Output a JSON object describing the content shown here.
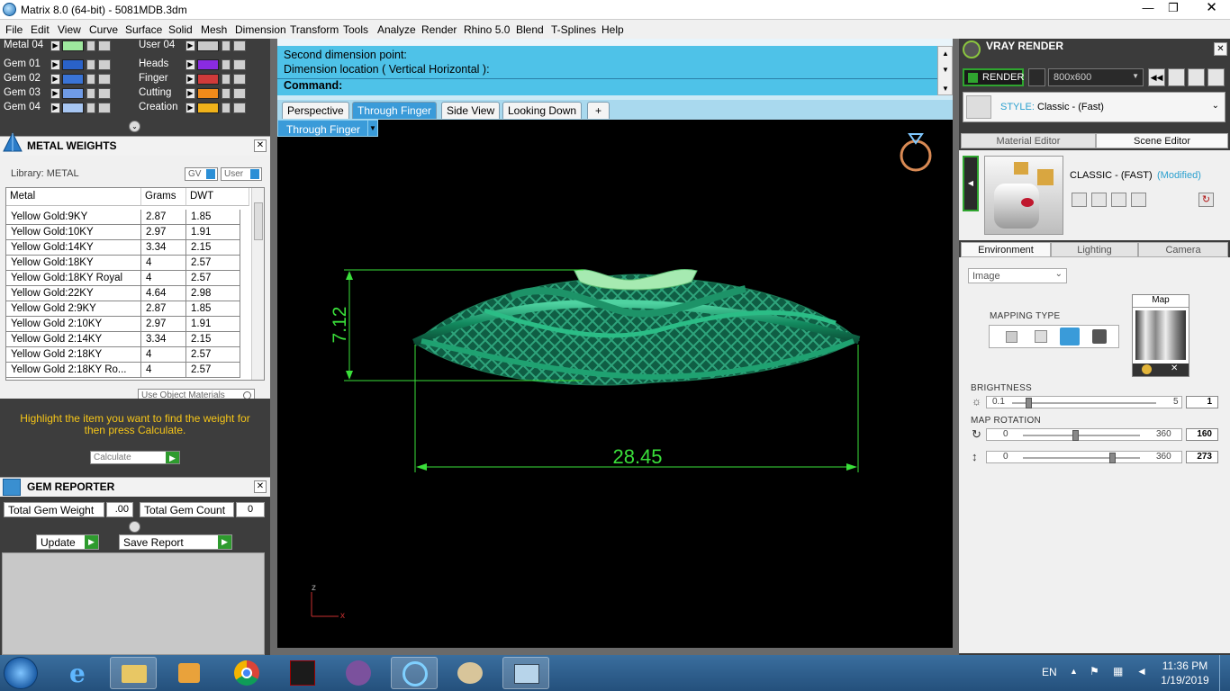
{
  "window": {
    "title": "Matrix 8.0 (64-bit) - 5081MDB.3dm"
  },
  "menu": [
    "File",
    "Edit",
    "View",
    "Curve",
    "Surface",
    "Solid",
    "Mesh",
    "Dimension",
    "Transform",
    "Tools",
    "Analyze",
    "Render",
    "Rhino 5.0",
    "Blend",
    "T-Splines",
    "Help"
  ],
  "layers": {
    "left": [
      {
        "name": "Metal 04",
        "color": "#9ee89e"
      },
      {
        "name": "Gem 01",
        "color": "#2a62c8"
      },
      {
        "name": "Gem 02",
        "color": "#3a74d6"
      },
      {
        "name": "Gem 03",
        "color": "#6f9be6"
      },
      {
        "name": "Gem 04",
        "color": "#a7c6f2"
      }
    ],
    "right": [
      {
        "name": "User 04",
        "color": "#c9c9c9"
      },
      {
        "name": "Heads",
        "color": "#8a2be2"
      },
      {
        "name": "Finger",
        "color": "#d13a3a"
      },
      {
        "name": "Cutting",
        "color": "#f08a1a"
      },
      {
        "name": "Creation",
        "color": "#f0b21a"
      }
    ]
  },
  "metal_weights": {
    "title": "METAL WEIGHTS",
    "library_label": "Library: METAL",
    "gv_label": "GV",
    "user_label": "User",
    "columns": [
      "Metal",
      "Grams",
      "DWT"
    ],
    "rows": [
      [
        "Yellow Gold:9KY",
        "2.87",
        "1.85"
      ],
      [
        "Yellow Gold:10KY",
        "2.97",
        "1.91"
      ],
      [
        "Yellow Gold:14KY",
        "3.34",
        "2.15"
      ],
      [
        "Yellow Gold:18KY",
        "4",
        "2.57"
      ],
      [
        "Yellow Gold:18KY Royal",
        "4",
        "2.57"
      ],
      [
        "Yellow Gold:22KY",
        "4.64",
        "2.98"
      ],
      [
        "Yellow Gold 2:9KY",
        "2.87",
        "1.85"
      ],
      [
        "Yellow Gold 2:10KY",
        "2.97",
        "1.91"
      ],
      [
        "Yellow Gold 2:14KY",
        "3.34",
        "2.15"
      ],
      [
        "Yellow Gold 2:18KY",
        "4",
        "2.57"
      ],
      [
        "Yellow Gold 2:18KY Ro...",
        "4",
        "2.57"
      ]
    ],
    "use_object_materials": "Use Object Materials",
    "hint": "Highlight the item you want to find the weight for then press Calculate.",
    "calculate": "Calculate"
  },
  "gem_reporter": {
    "title": "GEM REPORTER",
    "total_weight_label": "Total Gem Weight",
    "total_weight_value": ".00",
    "total_count_label": "Total Gem Count",
    "total_count_value": "0",
    "update": "Update",
    "save_report": "Save Report"
  },
  "command": {
    "line1": "Second dimension point:",
    "line2": "Dimension location ( Vertical  Horizontal ):",
    "prompt": "Command:"
  },
  "viewport_tabs": [
    {
      "label": "Perspective",
      "active": false
    },
    {
      "label": "Through Finger",
      "active": true
    },
    {
      "label": "Side View",
      "active": false
    },
    {
      "label": "Looking Down",
      "active": false
    }
  ],
  "viewport": {
    "name": "Through Finger",
    "dim_width": "28.45",
    "dim_height": "7.12",
    "axis_z": "z",
    "axis_x": "x"
  },
  "vray": {
    "title": "VRAY RENDER",
    "render_label": "RENDER",
    "resolution": "800x600",
    "style_label": "STYLE:",
    "style_value": "Classic - (Fast)",
    "editor_tabs": [
      "Material Editor",
      "Scene Editor"
    ],
    "scene_name": "CLASSIC - (FAST)",
    "scene_modified": "(Modified)",
    "env_tabs": [
      "Environment",
      "Lighting",
      "Camera"
    ],
    "env_type": "Image",
    "mapping_type_label": "MAPPING TYPE",
    "map_label": "Map",
    "brightness_label": "BRIGHTNESS",
    "brightness_min": "0.1",
    "brightness_max": "5",
    "brightness_value": "1",
    "brightness_level": 0.11,
    "map_rotation_label": "MAP ROTATION",
    "rot1_min": "0",
    "rot1_max": "360",
    "rot1_value": "160",
    "rot2_min": "0",
    "rot2_max": "360",
    "rot2_value": "273"
  },
  "tray": {
    "lang": "EN",
    "time": "11:36 PM",
    "date": "1/19/2019"
  }
}
